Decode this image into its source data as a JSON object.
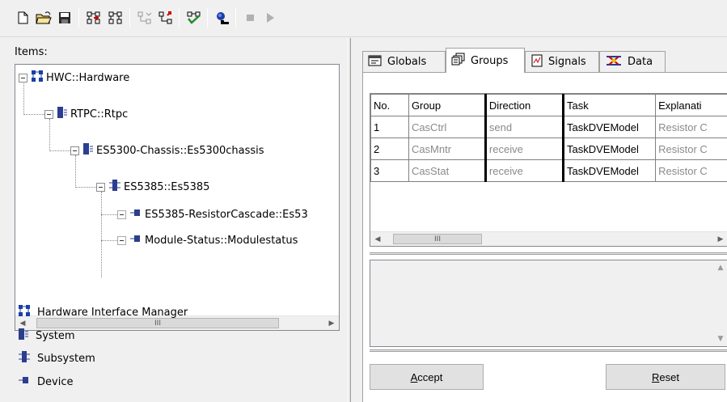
{
  "toolbar": {
    "buttons": [
      "new-file-icon",
      "open-folder-icon",
      "save-icon",
      "add-node-icon",
      "add-subnode-icon",
      "move-icon",
      "import-icon",
      "check-icon",
      "search-icon",
      "stop-icon",
      "play-icon"
    ]
  },
  "left": {
    "items_label": "Items:",
    "tree": [
      {
        "label": "HWC::Hardware"
      },
      {
        "label": "RTPC::Rtpc"
      },
      {
        "label": "ES5300-Chassis::Es5300chassis"
      },
      {
        "label": "ES5385::Es5385"
      },
      {
        "label": "ES5385-ResistorCascade::Es53"
      },
      {
        "label": "Module-Status::Modulestatus"
      }
    ],
    "scroll_thumb": "III",
    "legend": [
      {
        "label": "Hardware Interface Manager"
      },
      {
        "label": "System"
      },
      {
        "label": "Subsystem"
      },
      {
        "label": "Device"
      }
    ]
  },
  "right": {
    "tabs": [
      {
        "label": "Globals"
      },
      {
        "label": "Groups"
      },
      {
        "label": "Signals"
      },
      {
        "label": "Data"
      }
    ],
    "active_tab": "Groups",
    "table": {
      "headers": [
        "No.",
        "Group",
        "Direction",
        "Task",
        "Explanati"
      ],
      "rows": [
        [
          "1",
          "CasCtrl",
          "send",
          "TaskDVEModel",
          "Resistor C"
        ],
        [
          "2",
          "CasMntr",
          "receive",
          "TaskDVEModel",
          "Resistor C"
        ],
        [
          "3",
          "CasStat",
          "receive",
          "TaskDVEModel",
          "Resistor C"
        ]
      ]
    },
    "scroll_thumb": "III",
    "accept_prefix": "A",
    "accept_rest": "ccept",
    "reset_prefix": "R",
    "reset_rest": "eset"
  },
  "colors": {
    "accent_blue": "#1a3fa8",
    "grey_text": "#8a8a8a"
  }
}
